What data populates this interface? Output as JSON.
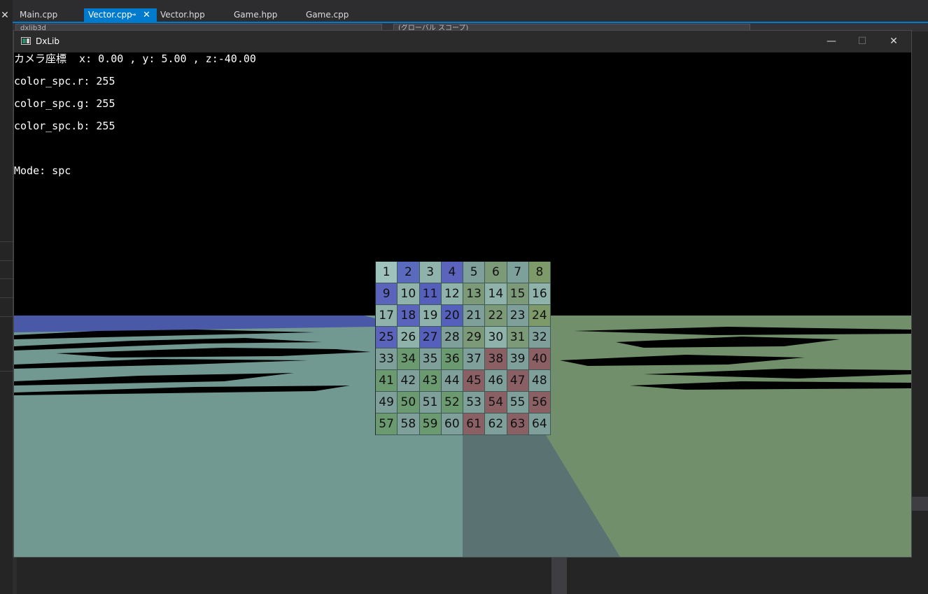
{
  "ide": {
    "tabs": [
      {
        "label": "Main.cpp",
        "active": false
      },
      {
        "label": "Vector.cpp",
        "active": true,
        "pin": "⊸",
        "close": "✕"
      },
      {
        "label": "Vector.hpp",
        "active": false
      },
      {
        "label": "Game.hpp",
        "active": false
      },
      {
        "label": "Game.cpp",
        "active": false
      }
    ],
    "close_glyph": "✕",
    "accent_color": "#007acc",
    "dropdowns": [
      {
        "label": "dxlib3d"
      },
      {
        "label": "(グローバル スコープ)"
      }
    ]
  },
  "window": {
    "title": "DxLib",
    "icon": "app-window-icon",
    "minimize_glyph": "—",
    "maximize_glyph": "☐",
    "close_glyph": "✕"
  },
  "hud": {
    "camera": "カメラ座標  x: 0.00 , y: 5.00 , z:-40.00",
    "color_r": "color_spc.r: 255",
    "color_g": "color_spc.g: 255",
    "color_b": "color_spc.b: 255",
    "mode": "Mode: spc"
  },
  "texture": {
    "rows": 8,
    "cols": 8,
    "labels": [
      [
        "1",
        "2",
        "3",
        "4",
        "5",
        "6",
        "7",
        "8"
      ],
      [
        "9",
        "10",
        "11",
        "12",
        "13",
        "14",
        "15",
        "16"
      ],
      [
        "17",
        "18",
        "19",
        "20",
        "21",
        "22",
        "23",
        "24"
      ],
      [
        "25",
        "26",
        "27",
        "28",
        "29",
        "30",
        "31",
        "32"
      ],
      [
        "33",
        "34",
        "35",
        "36",
        "37",
        "38",
        "39",
        "40"
      ],
      [
        "41",
        "42",
        "43",
        "44",
        "45",
        "46",
        "47",
        "48"
      ],
      [
        "49",
        "50",
        "51",
        "52",
        "53",
        "54",
        "55",
        "56"
      ],
      [
        "57",
        "58",
        "59",
        "60",
        "61",
        "62",
        "63",
        "64"
      ]
    ],
    "colors": [
      [
        "#9fc2bd",
        "#5a6bbd",
        "#8fb3aa",
        "#5a64bd",
        "#7fa09a",
        "#7d9a78",
        "#7ea09a",
        "#7d9a68"
      ],
      [
        "#5a64bd",
        "#8fb3aa",
        "#5560bd",
        "#8fb3aa",
        "#7d9a78",
        "#8fb3aa",
        "#7d9a78",
        "#8fb3aa"
      ],
      [
        "#8fb3aa",
        "#5a64bd",
        "#8fb3aa",
        "#5560bd",
        "#7fa09a",
        "#7d9a78",
        "#7fa09a",
        "#7d9a68"
      ],
      [
        "#5a64bd",
        "#8fb3aa",
        "#5560bd",
        "#7fa09a",
        "#7d9a78",
        "#8fb3aa",
        "#7d9a78",
        "#7fa09a"
      ],
      [
        "#7fa09a",
        "#6b9a70",
        "#7fa09a",
        "#6b9a70",
        "#7fa09a",
        "#8a6065",
        "#7fa09a",
        "#8a6065"
      ],
      [
        "#6b9a70",
        "#7fa09a",
        "#6b9a70",
        "#7fa09a",
        "#8a6065",
        "#7fa09a",
        "#8a6065",
        "#7fa09a"
      ],
      [
        "#7fa09a",
        "#6b9a70",
        "#7fa09a",
        "#6b9a70",
        "#7fa09a",
        "#8a6065",
        "#7fa09a",
        "#8a6065"
      ],
      [
        "#6b9a70",
        "#7fa09a",
        "#6b9a70",
        "#7fa09a",
        "#8a6065",
        "#7fa09a",
        "#8a6065",
        "#7fa09a"
      ]
    ]
  },
  "scene_colors": {
    "sky": "#000000",
    "ground_left": "#729892",
    "ground_center": "#5a7271",
    "ground_right": "#718f6a",
    "horizon_blue": "#4a58a8"
  }
}
